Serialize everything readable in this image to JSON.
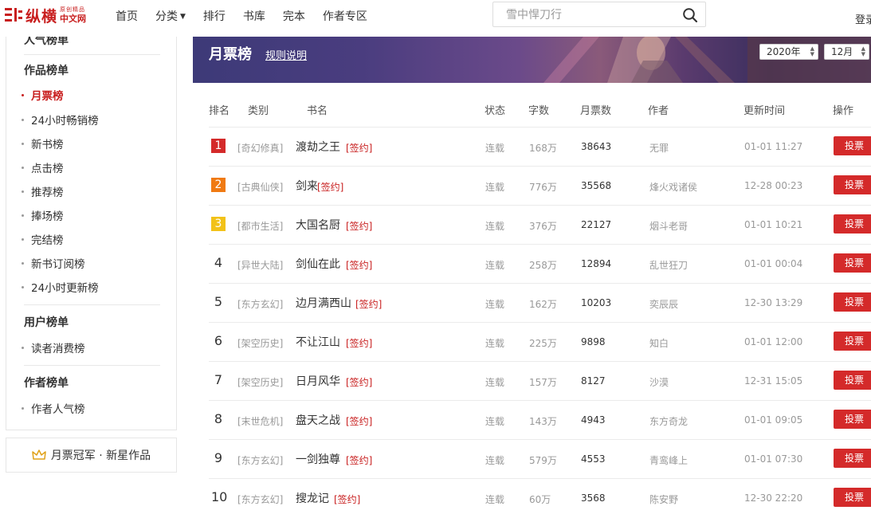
{
  "header": {
    "logo_main": "纵横",
    "logo_sub_top": "原创精品",
    "logo_sub_bottom": "中文网",
    "nav": [
      "首页",
      "分类",
      "排行",
      "书库",
      "完本",
      "作者专区"
    ],
    "search_placeholder": "雪中悍刀行",
    "login_label": "登录"
  },
  "sidebar": {
    "partial_top": "人气榜单",
    "sections": [
      {
        "title": "作品榜单",
        "items": [
          "月票榜",
          "24小时畅销榜",
          "新书榜",
          "点击榜",
          "推荐榜",
          "捧场榜",
          "完结榜",
          "新书订阅榜",
          "24小时更新榜"
        ]
      },
      {
        "title": "用户榜单",
        "items": [
          "读者消费榜"
        ]
      },
      {
        "title": "作者榜单",
        "items": [
          "作者人气榜"
        ]
      }
    ],
    "active_item": "月票榜",
    "champion_label": "月票冠军 · 新星作品"
  },
  "banner": {
    "title": "月票榜",
    "rules_link": "规则说明",
    "year_select": "2020年",
    "month_select": "12月"
  },
  "table": {
    "headers": [
      "排名",
      "类别",
      "书名",
      "状态",
      "字数",
      "月票数",
      "作者",
      "更新时间",
      "操作"
    ],
    "rows": [
      {
        "rank": "1",
        "category": "[奇幻修真]",
        "title": "渡劫之王",
        "sign": "[签约]",
        "status": "连载",
        "words": "168万",
        "votes": "38643",
        "author": "无罪",
        "updated": "01-01 11:27",
        "action": "投票"
      },
      {
        "rank": "2",
        "category": "[古典仙侠]",
        "title": "剑来",
        "sign": "[签约]",
        "status": "连载",
        "words": "776万",
        "votes": "35568",
        "author": "烽火戏诸侯",
        "updated": "12-28 00:23",
        "action": "投票"
      },
      {
        "rank": "3",
        "category": "[都市生活]",
        "title": "大国名厨",
        "sign": "[签约]",
        "status": "连载",
        "words": "376万",
        "votes": "22127",
        "author": "烟斗老哥",
        "updated": "01-01 10:21",
        "action": "投票"
      },
      {
        "rank": "4",
        "category": "[异世大陆]",
        "title": "剑仙在此",
        "sign": "[签约]",
        "status": "连载",
        "words": "258万",
        "votes": "12894",
        "author": "乱世狂刀",
        "updated": "01-01 00:04",
        "action": "投票"
      },
      {
        "rank": "5",
        "category": "[东方玄幻]",
        "title": "边月满西山",
        "sign": "[签约]",
        "status": "连载",
        "words": "162万",
        "votes": "10203",
        "author": "奕辰辰",
        "updated": "12-30 13:29",
        "action": "投票"
      },
      {
        "rank": "6",
        "category": "[架空历史]",
        "title": "不让江山",
        "sign": "[签约]",
        "status": "连载",
        "words": "225万",
        "votes": "9898",
        "author": "知白",
        "updated": "01-01 12:00",
        "action": "投票"
      },
      {
        "rank": "7",
        "category": "[架空历史]",
        "title": "日月风华",
        "sign": "[签约]",
        "status": "连载",
        "words": "157万",
        "votes": "8127",
        "author": "沙漠",
        "updated": "12-31 15:05",
        "action": "投票"
      },
      {
        "rank": "8",
        "category": "[末世危机]",
        "title": "盘天之战",
        "sign": "[签约]",
        "status": "连载",
        "words": "143万",
        "votes": "4943",
        "author": "东方奇龙",
        "updated": "01-01 09:05",
        "action": "投票"
      },
      {
        "rank": "9",
        "category": "[东方玄幻]",
        "title": "一剑独尊",
        "sign": "[签约]",
        "status": "连载",
        "words": "579万",
        "votes": "4553",
        "author": "青鸾峰上",
        "updated": "01-01 07:30",
        "action": "投票"
      },
      {
        "rank": "10",
        "category": "[东方玄幻]",
        "title": "搜龙记",
        "sign": "[签约]",
        "status": "连载",
        "words": "60万",
        "votes": "3568",
        "author": "陈安野",
        "updated": "12-30 22:20",
        "action": "投票"
      }
    ]
  },
  "colors": {
    "accent": "#c81e1e",
    "vote_button": "#d42a2a",
    "rank_1": "#d42a2a",
    "rank_2": "#f07a12",
    "rank_3": "#f2c218"
  }
}
